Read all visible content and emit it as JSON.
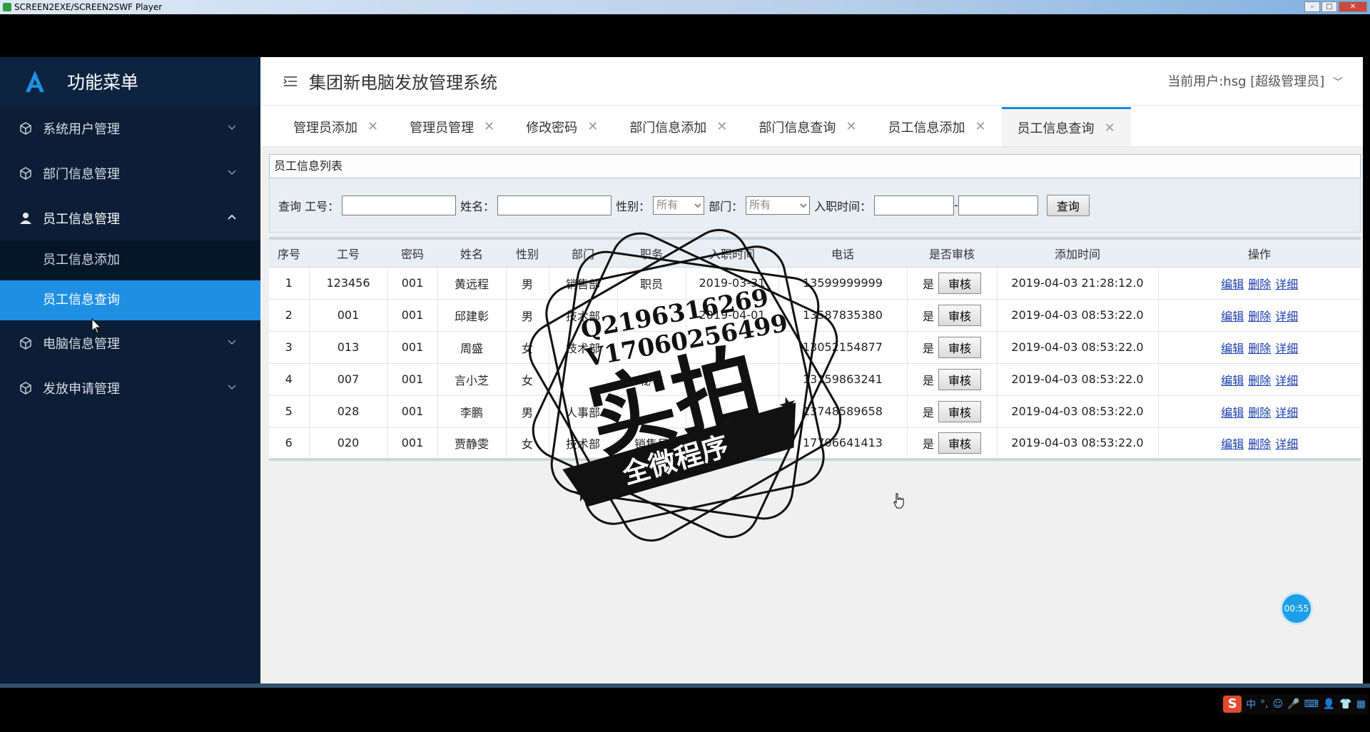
{
  "window": {
    "title": "SCREEN2EXE/SCREEN2SWF Player"
  },
  "sidebar": {
    "brand": "功能菜单",
    "items": [
      {
        "label": "系统用户管理",
        "open": false
      },
      {
        "label": "部门信息管理",
        "open": false
      },
      {
        "label": "员工信息管理",
        "open": true,
        "children": [
          "员工信息添加",
          "员工信息查询"
        ]
      },
      {
        "label": "电脑信息管理",
        "open": false
      },
      {
        "label": "发放申请管理",
        "open": false
      }
    ]
  },
  "header": {
    "title": "集团新电脑发放管理系统",
    "current_user": "当前用户:hsg [超级管理员]"
  },
  "tabs": [
    "管理员添加",
    "管理员管理",
    "修改密码",
    "部门信息添加",
    "部门信息查询",
    "员工信息添加",
    "员工信息查询"
  ],
  "panel": {
    "title": "员工信息列表",
    "search": {
      "query_label": "查询 工号：",
      "name_label": "姓名：",
      "gender_label": "性别：",
      "gender_selected": "所有",
      "dept_label": "部门：",
      "dept_selected": "所有",
      "hire_label": "入职时间：",
      "range_sep": "-",
      "query_button": "查询"
    },
    "columns": [
      "序号",
      "工号",
      "密码",
      "姓名",
      "性别",
      "部门",
      "职务",
      "入职时间",
      "电话",
      "是否审核",
      "添加时间",
      "操作"
    ],
    "rows": [
      {
        "no": "1",
        "id": "123456",
        "pwd": "001",
        "name": "黄远程",
        "gender": "男",
        "dept": "销售部",
        "title": "职员",
        "hired": "2019-03-31",
        "phone": "13599999999",
        "audited": "是",
        "added": "2019-04-03 21:28:12.0"
      },
      {
        "no": "2",
        "id": "001",
        "pwd": "001",
        "name": "邱建彰",
        "gender": "男",
        "dept": "技术部",
        "title": "",
        "hired": "2019-04-01",
        "phone": "13587835380",
        "audited": "是",
        "added": "2019-04-03 08:53:22.0"
      },
      {
        "no": "3",
        "id": "013",
        "pwd": "001",
        "name": "周盛",
        "gender": "女",
        "dept": "技术部",
        "title": "",
        "hired": "",
        "phone": "13052154877",
        "audited": "是",
        "added": "2019-04-03 08:53:22.0"
      },
      {
        "no": "4",
        "id": "007",
        "pwd": "001",
        "name": "言小芝",
        "gender": "女",
        "dept": "",
        "title": "秘书",
        "hired": "",
        "phone": "13159863241",
        "audited": "是",
        "added": "2019-04-03 08:53:22.0"
      },
      {
        "no": "5",
        "id": "028",
        "pwd": "001",
        "name": "李鹏",
        "gender": "男",
        "dept": "人事部",
        "title": "",
        "hired": "",
        "phone": "13748589658",
        "audited": "是",
        "added": "2019-04-03 08:53:22.0"
      },
      {
        "no": "6",
        "id": "020",
        "pwd": "001",
        "name": "贾静雯",
        "gender": "女",
        "dept": "技术部",
        "title": "销售员",
        "hired": "",
        "phone": "17706641413",
        "audited": "是",
        "added": "2019-04-03 08:53:22.0"
      }
    ],
    "audit_button": "审核",
    "actions": {
      "edit": "编辑",
      "delete": "删除",
      "detail": "详细"
    }
  },
  "stamp": {
    "line1": "Q2196316269",
    "line2": "V17060256499",
    "big": "实拍",
    "ribbon": "全微程序"
  },
  "timer": "00:55",
  "ime": {
    "label": "中",
    "logo": "S"
  },
  "colors": {
    "sidebar_bg": "#0b1e35",
    "active_item": "#1f8fe3",
    "tab_accent": "#1e88e5"
  }
}
